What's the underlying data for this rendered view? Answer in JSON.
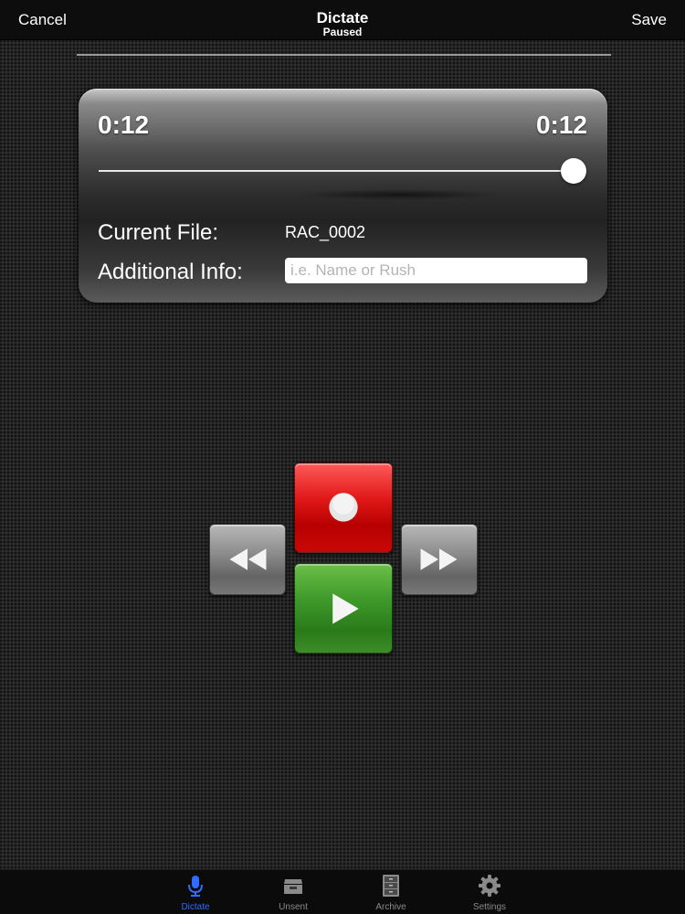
{
  "navbar": {
    "cancel_label": "Cancel",
    "title": "Dictate",
    "subtitle": "Paused",
    "save_label": "Save"
  },
  "player": {
    "elapsed": "0:12",
    "total": "0:12",
    "progress": 1.0
  },
  "details": {
    "current_file_label": "Current File:",
    "current_file_value": "RAC_0002",
    "additional_info_label": "Additional Info:",
    "additional_info_value": "",
    "additional_info_placeholder": "i.e. Name or Rush"
  },
  "controls": {
    "record_icon": "record-icon",
    "play_icon": "play-icon",
    "rewind_icon": "rewind-icon",
    "fast_forward_icon": "fast-forward-icon",
    "record_color": "#d40e0e",
    "play_color": "#3a8f26"
  },
  "tabbar": {
    "active_color": "#2f6cff",
    "tabs": [
      {
        "label": "Dictate",
        "icon": "microphone-icon",
        "active": true
      },
      {
        "label": "Unsent",
        "icon": "inbox-icon",
        "active": false
      },
      {
        "label": "Archive",
        "icon": "file-cabinet-icon",
        "active": false
      },
      {
        "label": "Settings",
        "icon": "gear-icon",
        "active": false
      }
    ]
  }
}
